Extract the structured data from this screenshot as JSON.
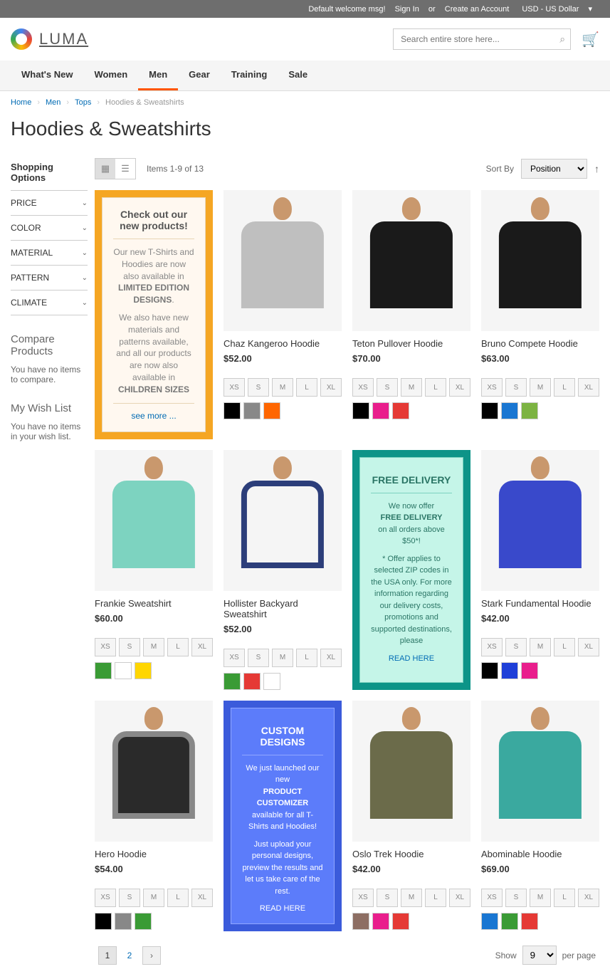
{
  "topbar": {
    "welcome": "Default welcome msg!",
    "signin": "Sign In",
    "or": "or",
    "create": "Create an Account",
    "currency": "USD - US Dollar"
  },
  "logo": "LUMA",
  "search": {
    "placeholder": "Search entire store here..."
  },
  "nav": [
    "What's New",
    "Women",
    "Men",
    "Gear",
    "Training",
    "Sale"
  ],
  "nav_active": 2,
  "breadcrumbs": [
    {
      "label": "Home",
      "link": true
    },
    {
      "label": "Men",
      "link": true
    },
    {
      "label": "Tops",
      "link": true
    },
    {
      "label": "Hoodies & Sweatshirts",
      "link": false
    }
  ],
  "page_title": "Hoodies & Sweatshirts",
  "sidebar": {
    "title": "Shopping Options",
    "filters": [
      "PRICE",
      "COLOR",
      "MATERIAL",
      "PATTERN",
      "CLIMATE"
    ],
    "compare": {
      "title": "Compare Products",
      "empty": "You have no items to compare."
    },
    "wishlist": {
      "title": "My Wish List",
      "empty": "You have no items in your wish list."
    }
  },
  "toolbar": {
    "items": "Items 1-9 of 13",
    "sortby": "Sort By",
    "sort_option": "Position"
  },
  "sizes5": [
    "XS",
    "S",
    "M",
    "L",
    "XL"
  ],
  "products": [
    {
      "name": "Chaz Kangeroo Hoodie",
      "price": "$52.00",
      "sizes": [
        "XS",
        "S",
        "M",
        "L",
        "XL"
      ],
      "colors": [
        "#000",
        "#888",
        "#ff6600"
      ],
      "img": "#bfbfbf"
    },
    {
      "name": "Teton Pullover Hoodie",
      "price": "$70.00",
      "sizes": [
        "XS",
        "S",
        "M",
        "L",
        "XL"
      ],
      "colors": [
        "#000",
        "#e91e8c",
        "#e53935"
      ],
      "img": "#1a1a1a"
    },
    {
      "name": "Bruno Compete Hoodie",
      "price": "$63.00",
      "sizes": [
        "XS",
        "S",
        "M",
        "L",
        "XL"
      ],
      "colors": [
        "#000",
        "#1976d2",
        "#7cb342"
      ],
      "img": "#1a1a1a"
    },
    {
      "name": "Frankie Sweatshirt",
      "price": "$60.00",
      "sizes": [
        "XS",
        "S",
        "M",
        "L",
        "XL"
      ],
      "colors": [
        "#3a9b35",
        "#fff",
        "#ffd600"
      ],
      "img": "#7dd3c0"
    },
    {
      "name": "Hollister Backyard Sweatshirt",
      "price": "$52.00",
      "sizes": [
        "XS",
        "S",
        "M",
        "L",
        "XL"
      ],
      "colors": [
        "#3a9b35",
        "#e53935",
        "#fff"
      ],
      "img": "#f5f5f5",
      "accent": "#2c3e7a"
    },
    {
      "name": "Stark Fundamental Hoodie",
      "price": "$42.00",
      "sizes": [
        "XS",
        "S",
        "M",
        "L",
        "XL"
      ],
      "colors": [
        "#000",
        "#1e3fd8",
        "#e91e8c"
      ],
      "img": "#3949cb"
    },
    {
      "name": "Hero Hoodie",
      "price": "$54.00",
      "sizes": [
        "XS",
        "S",
        "M",
        "L",
        "XL"
      ],
      "colors": [
        "#000",
        "#888",
        "#3a9b35"
      ],
      "img": "#2a2a2a",
      "accent": "#888"
    },
    {
      "name": "Oslo Trek Hoodie",
      "price": "$42.00",
      "sizes": [
        "XS",
        "S",
        "M",
        "L",
        "XL"
      ],
      "colors": [
        "#8d6e63",
        "#e91e8c",
        "#e53935"
      ],
      "img": "#6b6b4a"
    },
    {
      "name": "Abominable Hoodie",
      "price": "$69.00",
      "sizes": [
        "XS",
        "S",
        "M",
        "L",
        "XL"
      ],
      "colors": [
        "#1976d2",
        "#3a9b35",
        "#e53935"
      ],
      "img": "#3aa99f"
    }
  ],
  "promo1": {
    "title": "Check out our new products!",
    "p1a": "Our new T-Shirts and Hoodies are now also available in",
    "p1b": "LIMITED EDITION DESIGNS",
    "p2a": "We also have new materials and patterns available, and all our products are now also available in",
    "p2b": "CHILDREN SIZES",
    "link": "see more ..."
  },
  "promo2": {
    "title": "FREE DELIVERY",
    "p1a": "We now offer",
    "p1b": "FREE DELIVERY",
    "p1c": "on all orders above $50*!",
    "p2": "* Offer applies to selected ZIP codes in the USA only. For more information regarding our delivery costs, promotions and supported destinations, please",
    "link": "READ HERE"
  },
  "promo3": {
    "title": "CUSTOM DESIGNS",
    "p1a": "We just launched our new",
    "p1b": "PRODUCT CUSTOMIZER",
    "p1c": "available for all T-Shirts and Hoodies!",
    "p2": "Just upload your personal designs, preview the results and let us take care of the rest.",
    "link": "READ HERE"
  },
  "pagination": {
    "current": "1",
    "pages": [
      "2"
    ]
  },
  "limiter": {
    "show": "Show",
    "value": "9",
    "per": "per page"
  }
}
